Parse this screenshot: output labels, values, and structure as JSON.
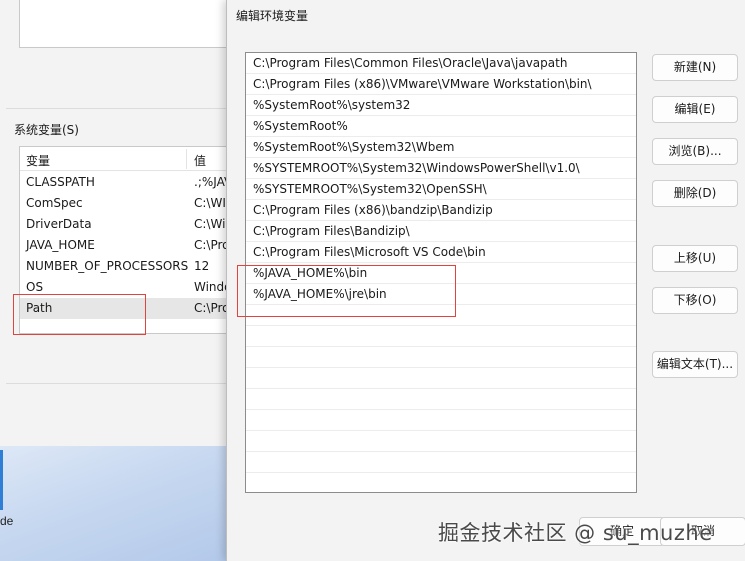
{
  "desktop": {
    "partial_label": "de"
  },
  "background_window": {
    "system_variables_label": "系统变量(S)",
    "columns": {
      "name": "变量",
      "value": "值"
    },
    "rows": [
      {
        "name": "CLASSPATH",
        "value": ".;%JAV"
      },
      {
        "name": "ComSpec",
        "value": "C:\\WI"
      },
      {
        "name": "DriverData",
        "value": "C:\\Wi"
      },
      {
        "name": "JAVA_HOME",
        "value": "C:\\Pro"
      },
      {
        "name": "NUMBER_OF_PROCESSORS",
        "value": "12"
      },
      {
        "name": "OS",
        "value": "Windo"
      },
      {
        "name": "Path",
        "value": "C:\\Pro",
        "selected": true
      }
    ]
  },
  "dialog": {
    "title": "编辑环境变量",
    "path_entries": [
      "C:\\Program Files\\Common Files\\Oracle\\Java\\javapath",
      "C:\\Program Files (x86)\\VMware\\VMware Workstation\\bin\\",
      "%SystemRoot%\\system32",
      "%SystemRoot%",
      "%SystemRoot%\\System32\\Wbem",
      "%SYSTEMROOT%\\System32\\WindowsPowerShell\\v1.0\\",
      "%SYSTEMROOT%\\System32\\OpenSSH\\",
      "C:\\Program Files (x86)\\bandzip\\Bandizip",
      "C:\\Program Files\\Bandizip\\",
      "C:\\Program Files\\Microsoft VS Code\\bin",
      "%JAVA_HOME%\\bin",
      "%JAVA_HOME%\\jre\\bin"
    ],
    "buttons": {
      "new": "新建(N)",
      "edit": "编辑(E)",
      "browse": "浏览(B)...",
      "delete": "删除(D)",
      "move_up": "上移(U)",
      "move_down": "下移(O)",
      "edit_text": "编辑文本(T)..."
    },
    "ok_label": "确定",
    "cancel_label": "取消"
  },
  "watermark": "掘金技术社区 @ su_muzhe",
  "colors": {
    "highlight": "#e0443e",
    "selected_row": "#e6e6e6"
  }
}
